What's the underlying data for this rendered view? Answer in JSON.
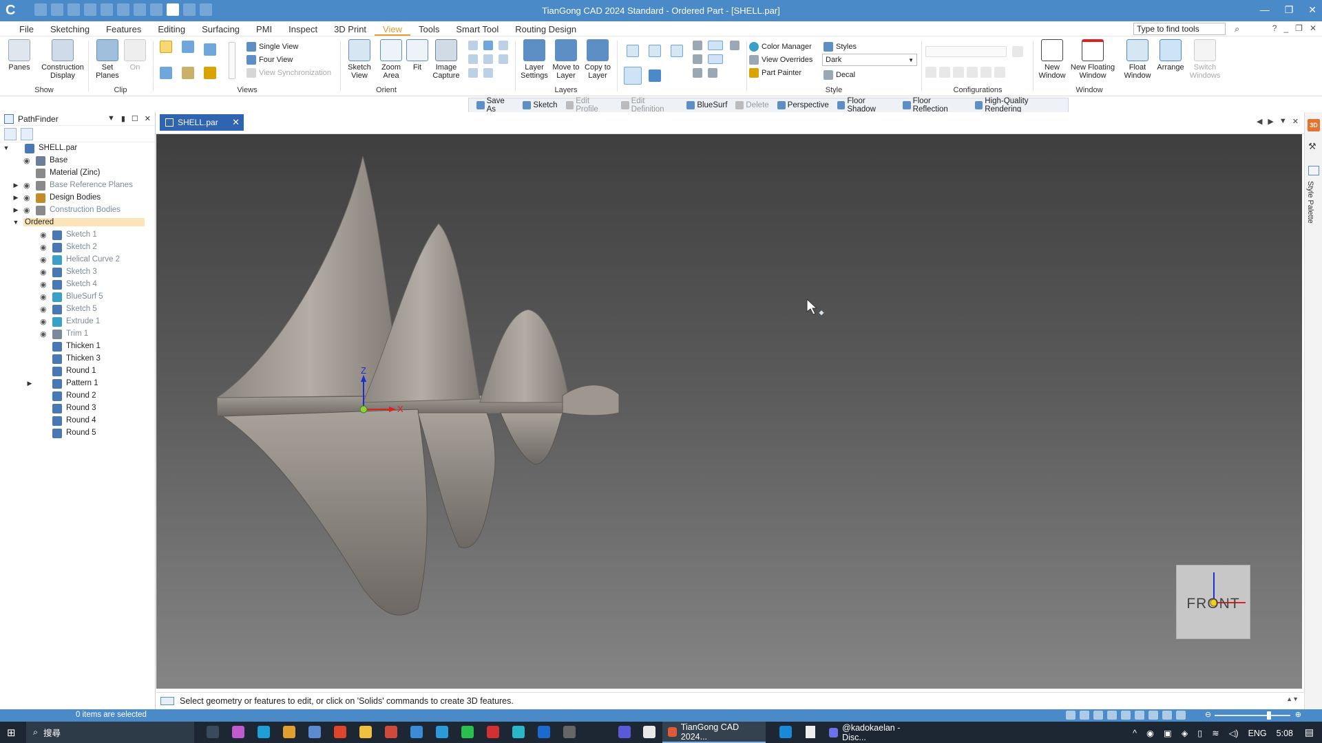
{
  "window": {
    "title": "TianGong CAD 2024 Standard - Ordered Part - [SHELL.par]",
    "controls": [
      "—",
      "❐",
      "✕"
    ]
  },
  "menu": {
    "tabs": [
      "File",
      "Sketching",
      "Features",
      "Editing",
      "Surfacing",
      "PMI",
      "Inspect",
      "3D Print",
      "View",
      "Tools",
      "Smart Tool",
      "Routing Design"
    ],
    "active_tab": "View",
    "search_placeholder": "Type to find tools"
  },
  "ribbon": {
    "show": {
      "label": "Show",
      "panes": "Panes",
      "construction_display": "Construction Display"
    },
    "clip": {
      "label": "Clip",
      "set_planes": "Set Planes",
      "on": "On"
    },
    "views": {
      "label": "Views",
      "single_view": "Single View",
      "four_view": "Four View",
      "view_sync": "View Synchronization"
    },
    "orient": {
      "label": "Orient",
      "sketch_view": "Sketch View",
      "zoom_area": "Zoom Area",
      "fit": "Fit",
      "image_capture": "Image Capture"
    },
    "layers": {
      "label": "Layers",
      "layer_settings": "Layer Settings",
      "move_to_layer": "Move to Layer",
      "copy_to_layer": "Copy to Layer"
    },
    "style": {
      "label": "Style",
      "color_manager": "Color Manager",
      "view_overrides": "View Overrides",
      "part_painter": "Part Painter",
      "styles": "Styles",
      "style_value": "Dark",
      "decal": "Decal"
    },
    "configurations": {
      "label": "Configurations"
    },
    "window": {
      "label": "Window",
      "new_window": "New Window",
      "new_floating_window": "New Floating Window",
      "float_window": "Float Window",
      "arrange": "Arrange",
      "switch_windows": "Switch Windows"
    }
  },
  "command_bar": [
    {
      "label": "Save As",
      "disabled": false
    },
    {
      "label": "Sketch",
      "disabled": false
    },
    {
      "label": "Edit Profile",
      "disabled": true
    },
    {
      "label": "Edit Definition",
      "disabled": true
    },
    {
      "label": "BlueSurf",
      "disabled": false
    },
    {
      "label": "Delete",
      "disabled": true
    },
    {
      "label": "Perspective",
      "disabled": false
    },
    {
      "label": "Floor Shadow",
      "disabled": false
    },
    {
      "label": "Floor Reflection",
      "disabled": false
    },
    {
      "label": "High-Quality Rendering",
      "disabled": false
    }
  ],
  "pathfinder": {
    "title": "PathFinder",
    "tree": [
      {
        "label": "SHELL.par",
        "level": 0,
        "expand": "▼",
        "eye": false,
        "icon": "part-icon",
        "color": "#4a78b5",
        "dim": false
      },
      {
        "label": "Base",
        "level": 1,
        "expand": "",
        "eye": true,
        "icon": "base-csys-icon",
        "color": "#6b7f99",
        "dim": false
      },
      {
        "label": "Material (Zinc)",
        "level": 1,
        "expand": "",
        "eye": false,
        "icon": "material-icon",
        "color": "#8a8a8a",
        "dim": false
      },
      {
        "label": "Base Reference Planes",
        "level": 1,
        "expand": "▶",
        "eye": true,
        "icon": "reference-planes-icon",
        "color": "#8a8a8a",
        "dim": true
      },
      {
        "label": "Design Bodies",
        "level": 1,
        "expand": "▶",
        "eye": true,
        "icon": "design-bodies-icon",
        "color": "#c58a2b",
        "dim": false
      },
      {
        "label": "Construction Bodies",
        "level": 1,
        "expand": "▶",
        "eye": true,
        "icon": "construction-bodies-icon",
        "color": "#8a8a8a",
        "dim": true
      },
      {
        "label": "Ordered",
        "level": 1,
        "expand": "▼",
        "eye": false,
        "icon": "",
        "color": "",
        "dim": false,
        "ordered": true
      },
      {
        "label": "Sketch 1",
        "level": 2,
        "expand": "",
        "eye": true,
        "icon": "sketch-icon",
        "color": "#4a78b5",
        "dim": true
      },
      {
        "label": "Sketch 2",
        "level": 2,
        "expand": "",
        "eye": true,
        "icon": "sketch-icon",
        "color": "#4a78b5",
        "dim": true
      },
      {
        "label": "Helical Curve 2",
        "level": 2,
        "expand": "",
        "eye": true,
        "icon": "helical-curve-icon",
        "color": "#3aa0c8",
        "dim": true
      },
      {
        "label": "Sketch 3",
        "level": 2,
        "expand": "",
        "eye": true,
        "icon": "sketch-icon",
        "color": "#4a78b5",
        "dim": true
      },
      {
        "label": "Sketch 4",
        "level": 2,
        "expand": "",
        "eye": true,
        "icon": "sketch-icon",
        "color": "#4a78b5",
        "dim": true
      },
      {
        "label": "BlueSurf 5",
        "level": 2,
        "expand": "",
        "eye": true,
        "icon": "bluesurf-icon",
        "color": "#3aa0c8",
        "dim": true
      },
      {
        "label": "Sketch 5",
        "level": 2,
        "expand": "",
        "eye": true,
        "icon": "sketch-icon",
        "color": "#4a78b5",
        "dim": true
      },
      {
        "label": "Extrude 1",
        "level": 2,
        "expand": "",
        "eye": true,
        "icon": "extrude-icon",
        "color": "#3aa0c8",
        "dim": true
      },
      {
        "label": "Trim 1",
        "level": 2,
        "expand": "",
        "eye": true,
        "icon": "trim-icon",
        "color": "#7a8a9c",
        "dim": true
      },
      {
        "label": "Thicken 1",
        "level": 2,
        "expand": "",
        "eye": false,
        "icon": "thicken-icon",
        "color": "#4a78b5",
        "dim": false
      },
      {
        "label": "Thicken 3",
        "level": 2,
        "expand": "",
        "eye": false,
        "icon": "thicken-icon",
        "color": "#4a78b5",
        "dim": false
      },
      {
        "label": "Round 1",
        "level": 2,
        "expand": "",
        "eye": false,
        "icon": "round-icon",
        "color": "#4a78b5",
        "dim": false
      },
      {
        "label": "Pattern 1",
        "level": 2,
        "expand": "▶",
        "eye": false,
        "icon": "pattern-icon",
        "color": "#4a78b5",
        "dim": false
      },
      {
        "label": "Round 2",
        "level": 2,
        "expand": "",
        "eye": false,
        "icon": "round-icon",
        "color": "#4a78b5",
        "dim": false
      },
      {
        "label": "Round 3",
        "level": 2,
        "expand": "",
        "eye": false,
        "icon": "round-icon",
        "color": "#4a78b5",
        "dim": false
      },
      {
        "label": "Round 4",
        "level": 2,
        "expand": "",
        "eye": false,
        "icon": "round-icon",
        "color": "#4a78b5",
        "dim": false
      },
      {
        "label": "Round 5",
        "level": 2,
        "expand": "",
        "eye": false,
        "icon": "round-icon",
        "color": "#4a78b5",
        "dim": false
      }
    ]
  },
  "document_tab": {
    "label": "SHELL.par"
  },
  "viewport": {
    "axis_labels": {
      "z": "Z",
      "x": "X"
    },
    "view_cube_label": "FRONT",
    "colors": {
      "model": "#a59e96",
      "axis_z": "#1a2fd0",
      "axis_x": "#e02020"
    }
  },
  "right_dock": {
    "tab_3d": "3D",
    "style_palette": "Style Palette"
  },
  "prompt": "Select geometry or features to edit, or click on 'Solids' commands to create 3D features.",
  "status": {
    "selection": "0 items are selected",
    "zoom_level": 0.72
  },
  "taskbar": {
    "search_label": "搜尋",
    "apps": [
      {
        "label": "TianGong CAD 2024...",
        "active": true,
        "color": "#e05a3a"
      },
      {
        "label": "@kadokaelan - Disc...",
        "active": false,
        "color": "#6b72e8"
      }
    ],
    "tray": {
      "lang": "ENG",
      "time": "5:08"
    }
  }
}
